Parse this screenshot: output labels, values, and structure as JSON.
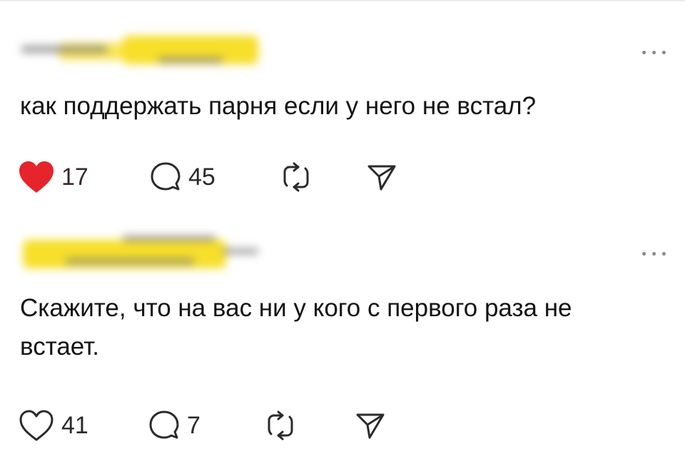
{
  "posts": [
    {
      "text": "как поддержать парня если у него не встал?",
      "likes": "17",
      "comments": "45",
      "liked": true,
      "like_color": "#e5242c",
      "icons": [
        "heart-icon",
        "comment-icon",
        "repost-icon",
        "share-icon",
        "more-options-icon"
      ]
    },
    {
      "text": "Скажите, что на вас ни у кого с первого раза не встает.",
      "likes": "41",
      "comments": "7",
      "liked": false,
      "icons": [
        "heart-icon",
        "comment-icon",
        "repost-icon",
        "share-icon",
        "more-options-icon"
      ]
    }
  ],
  "more_glyph": "•••",
  "colors": {
    "username_blur": "#f7df2a",
    "text": "#141414",
    "icon_stroke": "#2b2b2b",
    "like_active": "#e5242c"
  }
}
